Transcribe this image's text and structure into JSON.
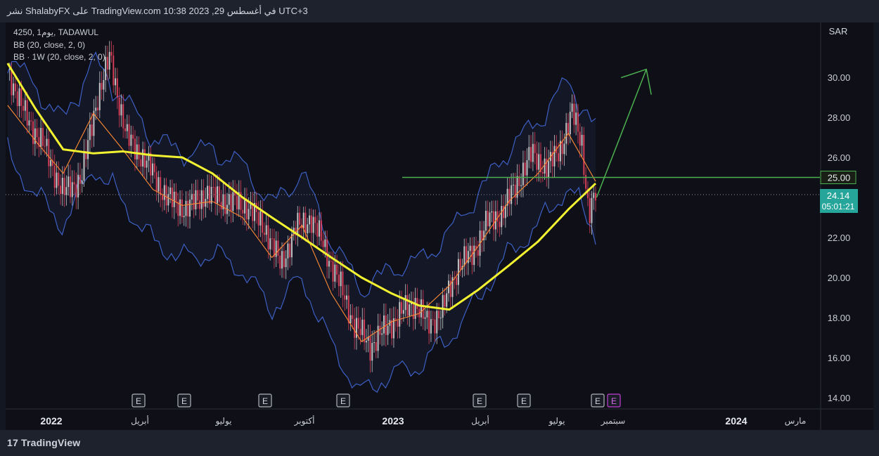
{
  "header": {
    "published_text": "نشر ShalabyFX على TradingView.com 10:38 2023 ,في أغسطس 29 UTC+3"
  },
  "legend": {
    "symbol_line": "4250, يوم1, TADAWUL",
    "indicator_1": "BB (20, close, 2, 0)",
    "indicator_2": "BB · 1W (20, close, 2, 0)"
  },
  "price_scale": {
    "currency": "SAR",
    "ticks": [
      "30.00",
      "28.00",
      "26.00",
      "25.00",
      "22.00",
      "20.00",
      "18.00",
      "16.00",
      "14.00"
    ]
  },
  "price_labels": {
    "horizontal_line": "25.00",
    "last_price": "24.14",
    "countdown": "05:01:21"
  },
  "time_axis": {
    "labels": [
      "2022",
      "أبريل",
      "يوليو",
      "أكتوبر",
      "2023",
      "أبريل",
      "يوليو",
      "سبتمبر",
      "2024",
      "مارس"
    ]
  },
  "earnings_markers": {
    "labels": [
      "E",
      "E",
      "E",
      "E",
      "E",
      "E",
      "E",
      "E"
    ]
  },
  "footer": {
    "brand": "TradingView",
    "logo_glyph": "17"
  },
  "colors": {
    "background": "#131722",
    "panel": "#0f1017",
    "bb_band": "#3d5fc4",
    "bb_basis": "#ff8a33",
    "ma_yellow": "#f2f230",
    "horizontal_line": "#4caf50",
    "up_candle": "#d4d4d4",
    "down_candle": "#e8415a",
    "last_price_bg": "#26a69a"
  },
  "chart_data": {
    "type": "line",
    "symbol": "4250",
    "exchange": "TADAWUL",
    "interval": "1D",
    "currency": "SAR",
    "ylim": [
      14,
      32
    ],
    "x_range": [
      "2022-01-01",
      "2024-04-15"
    ],
    "grid": false,
    "series": [
      {
        "name": "BB (20, close, 2, 0)",
        "type": "band-basis",
        "points": [
          [
            "2022-01-03",
            28.6
          ],
          [
            "2022-02-01",
            26.8
          ],
          [
            "2022-03-01",
            25.2
          ],
          [
            "2022-04-01",
            28.2
          ],
          [
            "2022-05-01",
            26.4
          ],
          [
            "2022-06-01",
            24.4
          ],
          [
            "2022-07-01",
            23.6
          ],
          [
            "2022-08-01",
            23.8
          ],
          [
            "2022-09-01",
            23.0
          ],
          [
            "2022-10-01",
            21.0
          ],
          [
            "2022-11-01",
            22.6
          ],
          [
            "2022-12-01",
            19.2
          ],
          [
            "2023-01-01",
            16.8
          ],
          [
            "2023-02-01",
            17.8
          ],
          [
            "2023-03-01",
            18.2
          ],
          [
            "2023-04-01",
            19.6
          ],
          [
            "2023-05-01",
            21.6
          ],
          [
            "2023-06-01",
            23.8
          ],
          [
            "2023-07-01",
            25.2
          ],
          [
            "2023-08-01",
            27.2
          ],
          [
            "2023-08-29",
            24.8
          ]
        ]
      },
      {
        "name": "BB · 1W (20, close, 2, 0)",
        "type": "moving-average",
        "points": [
          [
            "2022-01-03",
            30.7
          ],
          [
            "2022-02-01",
            28.4
          ],
          [
            "2022-03-01",
            26.4
          ],
          [
            "2022-04-01",
            26.2
          ],
          [
            "2022-05-01",
            26.3
          ],
          [
            "2022-06-01",
            26.1
          ],
          [
            "2022-07-01",
            26.0
          ],
          [
            "2022-08-01",
            25.2
          ],
          [
            "2022-09-01",
            24.0
          ],
          [
            "2022-10-01",
            23.0
          ],
          [
            "2022-11-01",
            22.0
          ],
          [
            "2022-12-01",
            21.0
          ],
          [
            "2023-01-01",
            20.0
          ],
          [
            "2023-02-01",
            19.2
          ],
          [
            "2023-03-01",
            18.6
          ],
          [
            "2023-04-01",
            18.4
          ],
          [
            "2023-05-01",
            19.4
          ],
          [
            "2023-06-01",
            20.6
          ],
          [
            "2023-07-01",
            21.8
          ],
          [
            "2023-08-01",
            23.4
          ],
          [
            "2023-08-29",
            24.7
          ]
        ]
      },
      {
        "name": "close",
        "type": "price",
        "points": [
          [
            "2022-01-03",
            30.4
          ],
          [
            "2022-01-20",
            28.2
          ],
          [
            "2022-02-10",
            26.5
          ],
          [
            "2022-03-01",
            24.2
          ],
          [
            "2022-03-20",
            25.0
          ],
          [
            "2022-04-05",
            29.0
          ],
          [
            "2022-04-18",
            31.0
          ],
          [
            "2022-05-05",
            27.0
          ],
          [
            "2022-05-25",
            25.8
          ],
          [
            "2022-06-15",
            24.0
          ],
          [
            "2022-07-05",
            23.4
          ],
          [
            "2022-07-25",
            24.2
          ],
          [
            "2022-08-15",
            23.8
          ],
          [
            "2022-09-05",
            23.6
          ],
          [
            "2022-09-25",
            22.4
          ],
          [
            "2022-10-10",
            20.6
          ],
          [
            "2022-10-25",
            22.4
          ],
          [
            "2022-11-10",
            23.0
          ],
          [
            "2022-11-25",
            21.4
          ],
          [
            "2022-12-10",
            19.6
          ],
          [
            "2022-12-25",
            17.6
          ],
          [
            "2023-01-10",
            16.6
          ],
          [
            "2023-01-25",
            17.4
          ],
          [
            "2023-02-10",
            18.2
          ],
          [
            "2023-02-25",
            18.8
          ],
          [
            "2023-03-10",
            17.6
          ],
          [
            "2023-03-25",
            18.4
          ],
          [
            "2023-04-10",
            20.6
          ],
          [
            "2023-04-25",
            21.2
          ],
          [
            "2023-05-10",
            22.8
          ],
          [
            "2023-05-25",
            23.2
          ],
          [
            "2023-06-10",
            24.8
          ],
          [
            "2023-06-25",
            26.2
          ],
          [
            "2023-07-10",
            25.4
          ],
          [
            "2023-07-25",
            26.6
          ],
          [
            "2023-08-05",
            28.2
          ],
          [
            "2023-08-15",
            26.8
          ],
          [
            "2023-08-22",
            23.0
          ],
          [
            "2023-08-29",
            24.14
          ]
        ]
      }
    ],
    "annotations": [
      {
        "type": "horizontal_line",
        "value": 25.0
      },
      {
        "type": "arrow",
        "from": [
          "2023-08-30",
          24.0
        ],
        "to": [
          "2023-10-20",
          30.4
        ]
      }
    ]
  }
}
